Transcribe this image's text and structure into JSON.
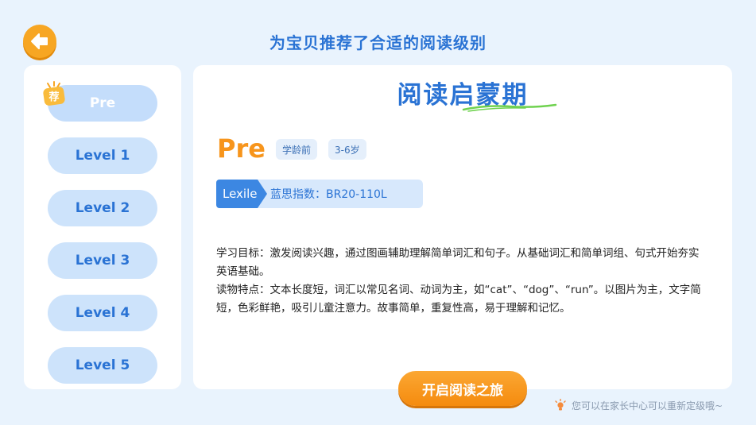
{
  "header": {
    "title": "为宝贝推荐了合适的阅读级别",
    "back_icon": "arrow-left-icon"
  },
  "sidebar": {
    "recommended_badge": "荐",
    "items": [
      {
        "label": "Pre",
        "selected": true,
        "recommended": true
      },
      {
        "label": "Level 1",
        "selected": false
      },
      {
        "label": "Level 2",
        "selected": false
      },
      {
        "label": "Level 3",
        "selected": false
      },
      {
        "label": "Level 4",
        "selected": false
      },
      {
        "label": "Level 5",
        "selected": false
      }
    ]
  },
  "main": {
    "stage_title": "阅读启蒙期",
    "level_name": "Pre",
    "tags": [
      "学龄前",
      "3-6岁"
    ],
    "lexile": {
      "label": "Lexile",
      "value": "蓝思指数：BR20-110L"
    },
    "goal": "学习目标：激发阅读兴趣，通过图画辅助理解简单词汇和句子。从基础词汇和简单词组、句式开始夯实英语基础。",
    "features": "读物特点：文本长度短，词汇以常见名词、动词为主，如“cat”、“dog”、“run”。以图片为主，文字简短，色彩鲜艳，吸引儿童注意力。故事简单，重复性高，易于理解和记忆。"
  },
  "actions": {
    "start_label": "开启阅读之旅"
  },
  "footer": {
    "hint": "您可以在家长中心可以重新定级哦~",
    "hint_icon": "lightbulb-icon"
  },
  "colors": {
    "accent_blue": "#2a73d4",
    "accent_orange": "#f7951c",
    "background": "#e9f3fd"
  }
}
